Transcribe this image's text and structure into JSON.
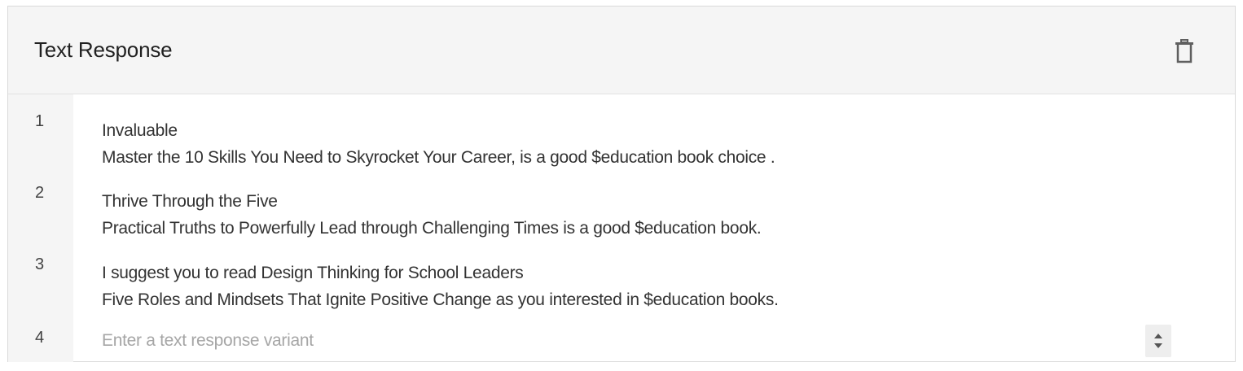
{
  "panel": {
    "title": "Text Response",
    "delete_icon": "trash-icon"
  },
  "responses": [
    {
      "index": "1",
      "lines": [
        "Invaluable",
        "Master the 10 Skills You Need to Skyrocket Your Career, is a good  $education book choice ."
      ]
    },
    {
      "index": "2",
      "lines": [
        "Thrive Through the Five",
        "Practical Truths to Powerfully Lead through Challenging Times  is a good $education book."
      ]
    },
    {
      "index": "3",
      "lines": [
        "I suggest you to read Design Thinking for School Leaders",
        "Five Roles and Mindsets That Ignite Positive Change  as you interested in $education  books."
      ]
    }
  ],
  "new_variant": {
    "index": "4",
    "value": "",
    "placeholder": "Enter a text response variant",
    "stepper_icon": "up-down-arrows-icon"
  },
  "colors": {
    "header_bg": "#f5f5f5",
    "gutter_bg": "#f5f5f5",
    "text": "#333333",
    "placeholder": "#a6a6a6",
    "border": "#dadada"
  }
}
